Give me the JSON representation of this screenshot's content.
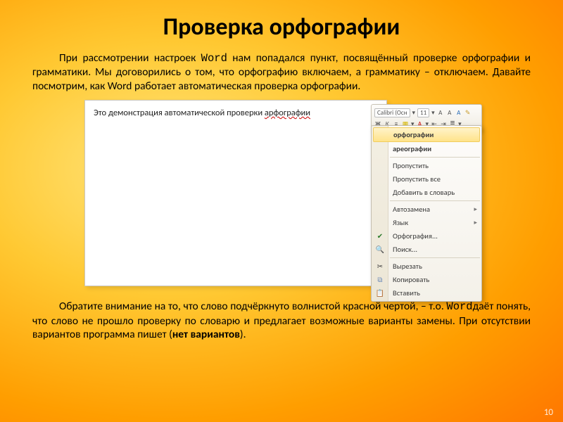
{
  "title": "Проверка орфографии",
  "para1_a": "При рассмотрении настроек ",
  "para1_word": "Word",
  "para1_b": " нам попадался пункт, посвящённый проверке орфографии и грамматики.  Мы договорились о том, что орфографию включаем, а грамматику – отключаем. Давайте посмотрим, как Word работает автоматическая проверка орфографии.",
  "doc_text_a": "Это демонстрация автоматической проверки ",
  "doc_misspelled": "арфографии",
  "mini": {
    "font": "Calibri (Осн",
    "size": "11"
  },
  "menu": {
    "s1": "орфографии",
    "s2": "ареографии",
    "skip": "Пропустить",
    "skip_all": "Пропустить все",
    "add_dict": "Добавить в словарь",
    "autocorrect": "Автозамена",
    "language": "Язык",
    "spelling": "Орфография...",
    "lookup": "Поиск...",
    "cut": "Вырезать",
    "copy": "Копировать",
    "paste": "Вставить"
  },
  "para2_a": "Обратите внимание на то, что слово подчёркнуто волнистой красной чертой, – т.о. ",
  "para2_word": "Word",
  "para2_b": "даёт понять, что слово не прошло проверку по словарю и предлагает возможные варианты замены. При отсутствии вариантов программа пишет (",
  "para2_bold": "нет вариантов",
  "para2_c": ").",
  "page_num": "10"
}
